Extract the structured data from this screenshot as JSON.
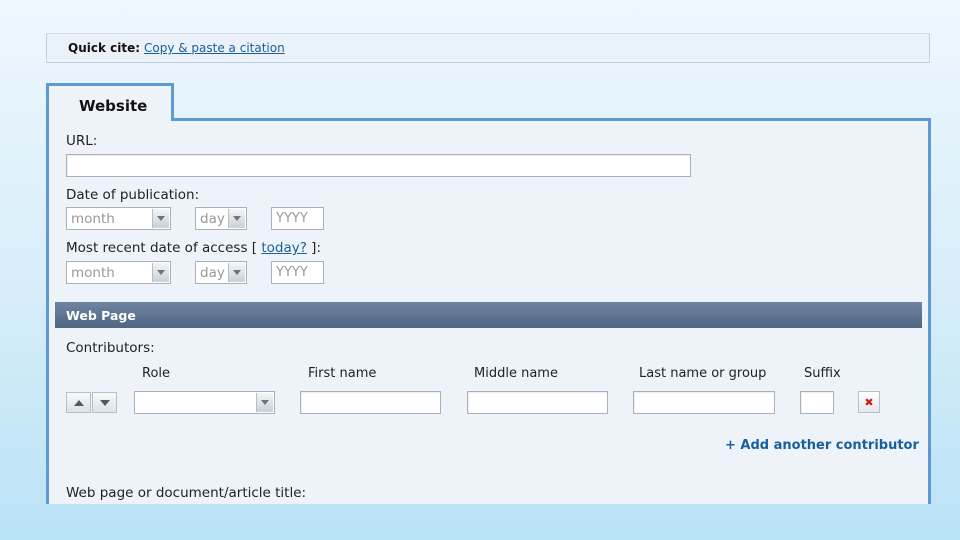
{
  "quick_cite": {
    "label": "Quick cite:",
    "link": "Copy & paste a citation"
  },
  "tab": {
    "label": "Website"
  },
  "url": {
    "label": "URL:",
    "value": ""
  },
  "publication_date": {
    "label": "Date of publication:",
    "month": "month",
    "day": "day",
    "year_placeholder": "YYYY"
  },
  "access_date": {
    "label_before": "Most recent date of access [ ",
    "today_link": "today?",
    "label_after": " ]:",
    "month": "month",
    "day": "day",
    "year_placeholder": "YYYY"
  },
  "section": {
    "title": "Web Page"
  },
  "contributors": {
    "label": "Contributors:",
    "columns": {
      "role": "Role",
      "first": "First name",
      "middle": "Middle name",
      "last": "Last name or group",
      "suffix": "Suffix"
    },
    "add_label": "+ Add another contributor"
  },
  "title_field": {
    "label": "Web page or document/article title:"
  },
  "icons": {
    "move_up": "triangle-up-icon",
    "move_down": "triangle-down-icon",
    "delete": "red-x-icon",
    "dropdown": "chevron-down-icon"
  },
  "colors": {
    "accent": "#5d9ad2",
    "link": "#1b5f9a",
    "section_bar": "#5a6f8b"
  }
}
